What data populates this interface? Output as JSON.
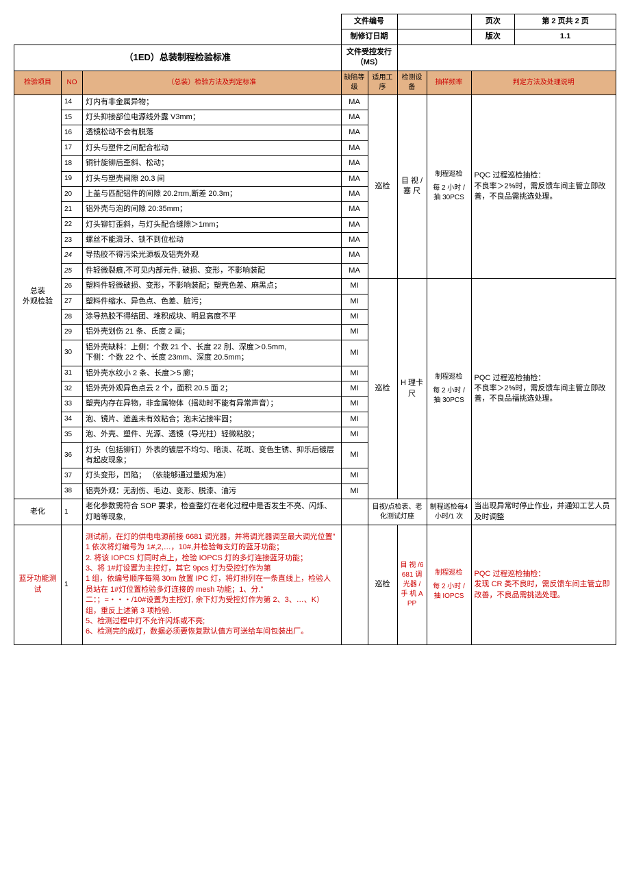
{
  "header": {
    "doc_no_label": "文件编号",
    "doc_no_value": "",
    "page_label": "页次",
    "page_value": "第 2 页共 2 页",
    "rev_date_label": "制修订日期",
    "rev_date_value": "",
    "ver_label": "版次",
    "ver_value": "1.1",
    "issue_label": "文件受控发行（MS）",
    "issue_value": "",
    "title": "（1ED）总装制程检验标准"
  },
  "columns": {
    "item": "检验项目",
    "no": "NO",
    "method": "（总装）检验方法及判定标准",
    "defect": "缺陷等级",
    "process": "适用工序",
    "equip": "检测设备",
    "freq": "抽样频率",
    "judge": "判定方法及处理说明"
  },
  "group1": {
    "item": "总装\n外观检验",
    "process": "巡检",
    "equip": "目 视 / 塞 尺",
    "freq_title": "制程巡检",
    "freq_body": "每 2 小时 / 抽 30PCS",
    "judge": "PQC 过程巡检抽检：\n不良率＞2%时，需反馈车间主管立即改善，不良品需挑选处理。",
    "rows": [
      {
        "no": "14",
        "m": "灯内有非金属异物；",
        "d": "MA"
      },
      {
        "no": "15",
        "m": "灯头抑接部位电源线外露 V3mm；",
        "d": "MA"
      },
      {
        "no": "16",
        "m": "透镜松动不会有脱落",
        "d": "MA"
      },
      {
        "no": "17",
        "m": "灯头与塑件之间配合松动",
        "d": "MA"
      },
      {
        "no": "18",
        "m": "铜针旋铆后歪斜、松动；",
        "d": "MA"
      },
      {
        "no": "19",
        "m": "灯头与塑壳间隙 20.3 间",
        "d": "MA"
      },
      {
        "no": "20",
        "m": "上盖与匹配铝件的间隙 20.2πm,断差 20.3m；",
        "d": "MA"
      },
      {
        "no": "21",
        "m": "铝外壳与泡的间隙 20:35mm；",
        "d": "MA"
      },
      {
        "no": "22",
        "m": "灯头铆钉歪斜，与灯头配合缝隙＞1mm；",
        "d": "MA"
      },
      {
        "no": "23",
        "m": "螺丝不能滑牙、锁不到位松动",
        "d": "MA"
      },
      {
        "no": "24",
        "m": "导热胶不得污染光源板及铝壳外观",
        "d": "MA"
      },
      {
        "no": "25",
        "m": "件轻微裂痕,不可见内部元件,  破损、变形，不影响装配",
        "d": "MA"
      }
    ]
  },
  "group2": {
    "process": "巡检",
    "equip": "H 理卡尺",
    "freq_title": "制程巡检",
    "freq_body": "每 2 小时 / 抽 30PCS",
    "judge": "PQC 过程巡检抽检：\n不良率＞2%时，需反馈车间主管立即改善，不良品福挑选处理。",
    "rows": [
      {
        "no": "26",
        "m": "塑料件轻微破损、变形，不影响装配；塑壳色差、麻黑点；",
        "d": "MI"
      },
      {
        "no": "27",
        "m": "塑料件缩水、异色点、色差、脏污；",
        "d": "MI"
      },
      {
        "no": "28",
        "m": "涂导热胶不得结团、堆积成块、明显高度不平",
        "d": "MI"
      },
      {
        "no": "29",
        "m": "铝外壳划伤 21 条、氏度 2 画；",
        "d": "MI"
      },
      {
        "no": "30",
        "m": "铝外壳缺料：上侧：个数 21 个、长度 22 刖、深度＞0.5mm,\n下侧：个数 22 个、长度 23mm、深度 20.5mm；",
        "d": "MI"
      },
      {
        "no": "31",
        "m": "铝外壳水纹小 2 条、长度＞5 廊；",
        "d": "MI"
      },
      {
        "no": "32",
        "m": "铝外壳外观异色点云 2 个，面积 20.5 面 2；",
        "d": "MI"
      },
      {
        "no": "33",
        "m": "塑壳内存在异物，非金属物体（摇动时不能有异常声音）；",
        "d": "MI"
      },
      {
        "no": "34",
        "m": "泡、镜片、遮盖未有效粘合；泡未沾接牢固；",
        "d": "MI"
      },
      {
        "no": "35",
        "m": "    泡、外壳、塑件、光源、透镜（导光柱）轻微粘胶；",
        "d": "MI"
      },
      {
        "no": "36",
        "m": "灯头（包括铆钉）外表的镀层不均匀、暗淡、花斑、变色生锈、抑乐后镀层有起皮现象；",
        "d": "MI"
      },
      {
        "no": "37",
        "m": "灯头变形，凹陷；  （依能够通过量规为准）",
        "d": "MI"
      },
      {
        "no": "38",
        "m": "铝壳外观：无刮伤、毛边、变形、脱漆、油污",
        "d": "MI"
      }
    ]
  },
  "aging": {
    "item": "老化",
    "no": "1",
    "method": "老化参数需符合 SOP 要求，检查整灯在老化过程中是否发生不亮、闪烁、灯暗等现象,",
    "defect": "",
    "process": "目视/点检表、老化测试灯座",
    "equip": "",
    "freq": "制程巡检每4 小时/1 次",
    "judge": "当出现异常时停止作业，并通知工艺人员及时调整"
  },
  "bt": {
    "item": "蓝牙功能测试",
    "no": "1",
    "method": "测试前，在灯的供电电源前接 6681 调光器，并将调光器调至最大调光位置”\n1 依次将灯编号为 1#,2,…，10#,并检验每支灯的蓝牙功能；\n2. 将该 IOPCS 灯同时点上，检验 IOPCS 灯的多灯连接蓝牙功能；\n3、将 1#灯设置为主控灯，其它 9pcs 灯为受控灯作为第\n1 组，依编号顺序每隔 30m 放置 IPC 灯，将灯排列在一条直线上，检验人员站在 1#灯位置检验多灯连接的 mesh 功能；1、分.”\n二：；=・・・/10#设置为主控灯, 余下灯为受控灯作为第 2、3、…、K）组，重反上述第 3 项检验.\n5、检测过程中灯不允许闪烁或不亮;\n6、检测完的成灯，数据必须要恢复默认值方可送给车间包装出厂。",
    "defect": "",
    "process": "巡检",
    "equip": "目 视 /6681 调光器 / 手 机 APP",
    "freq_title": "制程巡检",
    "freq_body": "每 2 小时 / 抽 IOPCS",
    "judge": "PQC 过程巡检抽检：\n发现 CR 类不良时，需反馈车间主管立即改善，不良品需挑选处理。"
  }
}
